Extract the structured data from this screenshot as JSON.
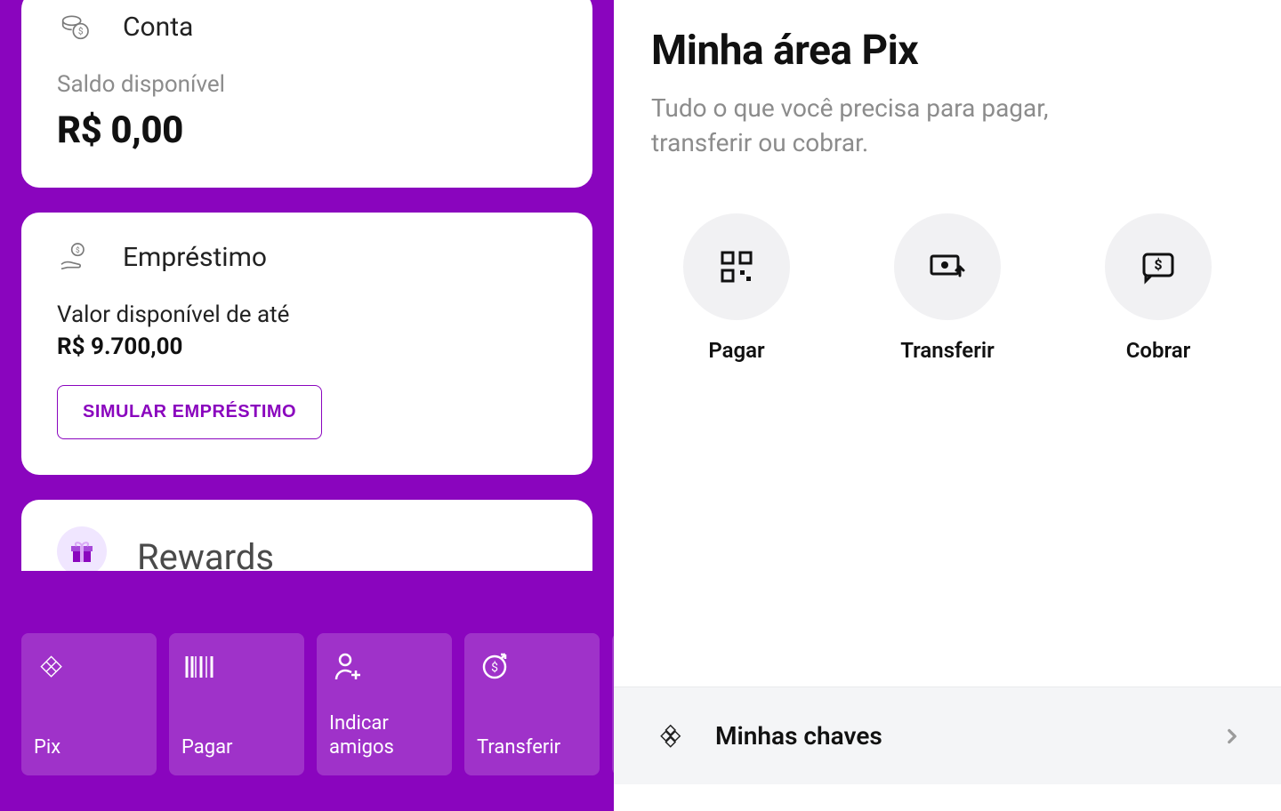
{
  "left": {
    "account": {
      "title": "Conta",
      "balance_label": "Saldo disponível",
      "balance_value": "R$ 0,00"
    },
    "loan": {
      "title": "Empréstimo",
      "available_label": "Valor disponível de até",
      "available_value": "R$ 9.700,00",
      "cta": "SIMULAR EMPRÉSTIMO"
    },
    "rewards": {
      "title": "Rewards"
    },
    "shortcuts": [
      {
        "id": "pix",
        "label": "Pix"
      },
      {
        "id": "pagar",
        "label": "Pagar"
      },
      {
        "id": "indicar",
        "label": "Indicar\namigos"
      },
      {
        "id": "transferir",
        "label": "Transferir"
      }
    ]
  },
  "right": {
    "title": "Minha área Pix",
    "subtitle": "Tudo o que você precisa para pagar, transferir ou cobrar.",
    "actions": [
      {
        "id": "pagar",
        "label": "Pagar"
      },
      {
        "id": "transferir",
        "label": "Transferir"
      },
      {
        "id": "cobrar",
        "label": "Cobrar"
      }
    ],
    "list": {
      "keys_label": "Minhas chaves"
    }
  }
}
